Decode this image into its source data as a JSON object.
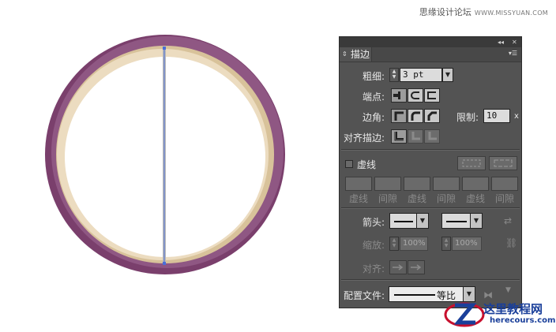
{
  "watermark": {
    "text": "思缘设计论坛",
    "site": "WWW.MISSYUAN.COM"
  },
  "panel": {
    "tab_label": "描边",
    "weight": {
      "label": "粗细:",
      "value": "3 pt"
    },
    "cap": {
      "label": "端点:"
    },
    "corner": {
      "label": "边角:",
      "limit_label": "限制:",
      "limit_value": "10",
      "limit_suffix": "x"
    },
    "align": {
      "label": "对齐描边:"
    },
    "dashed": {
      "label": "虚线",
      "labels": [
        "虚线",
        "间隙",
        "虚线",
        "间隙",
        "虚线",
        "间隙"
      ]
    },
    "arrowheads": {
      "label": "箭头:"
    },
    "scale": {
      "label": "缩放:",
      "start": "100%",
      "end": "100%"
    },
    "arrow_align": {
      "label": "对齐:"
    },
    "profile": {
      "label": "配置文件:",
      "value": "等比"
    }
  },
  "logo": {
    "zh": "这里教程网",
    "en": "herecours.com"
  },
  "colors": {
    "ring_outer": "#7a3f6c",
    "ring_highlight": "#8f5783",
    "ring_inner": "#d8c29a",
    "ring_inner_light": "#ecdcc0",
    "panel_bg": "#535353",
    "guide_line": "#4a6ed8"
  }
}
